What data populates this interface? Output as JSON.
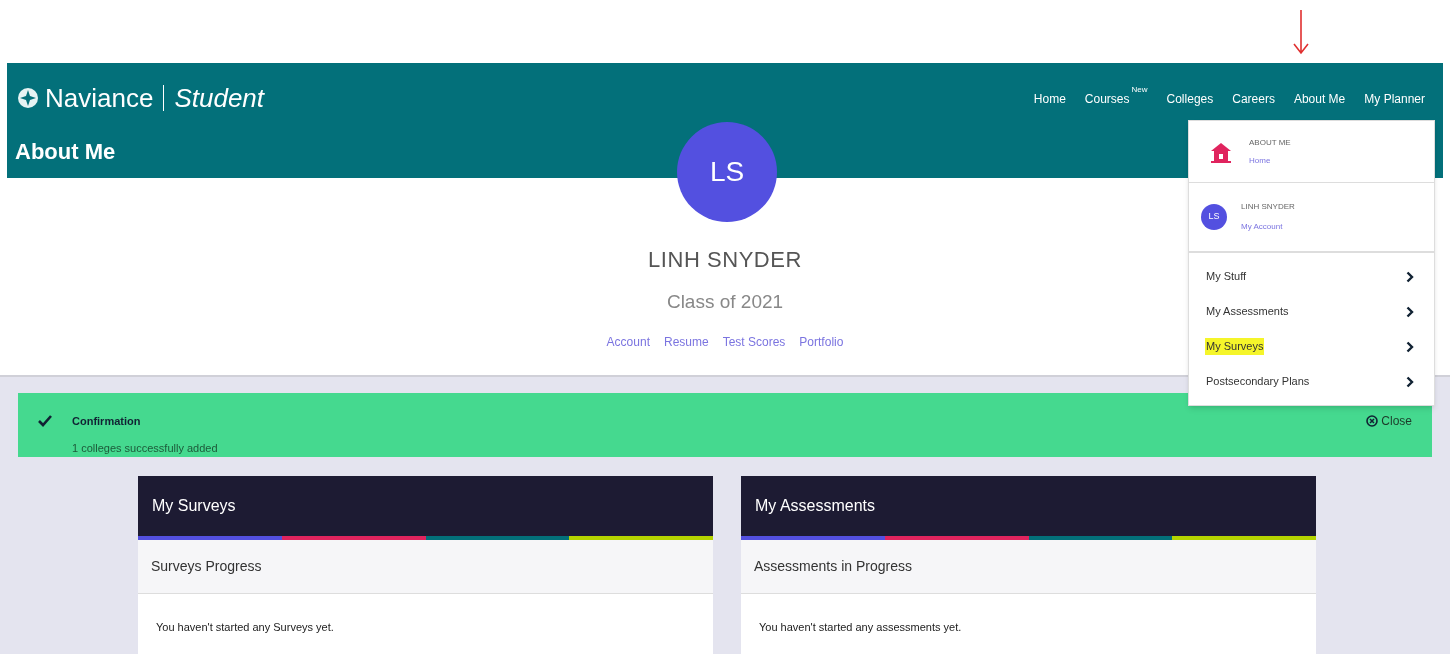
{
  "brand": {
    "name": "Naviance",
    "product": "Student"
  },
  "nav": [
    {
      "label": "Home"
    },
    {
      "label": "Courses",
      "badge": "New"
    },
    {
      "label": "Colleges"
    },
    {
      "label": "Careers"
    },
    {
      "label": "About Me"
    },
    {
      "label": "My Planner"
    }
  ],
  "page_title": "About Me",
  "profile": {
    "initials": "LS",
    "name": "LINH SNYDER",
    "class": "Class of 2021",
    "links": [
      "Account",
      "Resume",
      "Test Scores",
      "Portfolio"
    ]
  },
  "dropdown": {
    "section": {
      "title": "ABOUT ME",
      "link": "Home"
    },
    "user": {
      "initials": "LS",
      "name": "LINH SNYDER",
      "link": "My Account"
    },
    "items": [
      {
        "label": "My Stuff",
        "highlighted": false
      },
      {
        "label": "My Assessments",
        "highlighted": false
      },
      {
        "label": "My Surveys",
        "highlighted": true
      },
      {
        "label": "Postsecondary Plans",
        "highlighted": false
      }
    ]
  },
  "alert": {
    "title": "Confirmation",
    "message": "1 colleges successfully added",
    "close": "Close"
  },
  "cards": [
    {
      "title": "My Surveys",
      "subtitle": "Surveys Progress",
      "body": "You haven't started any Surveys yet."
    },
    {
      "title": "My Assessments",
      "subtitle": "Assessments in Progress",
      "body": "You haven't started any assessments yet."
    }
  ]
}
